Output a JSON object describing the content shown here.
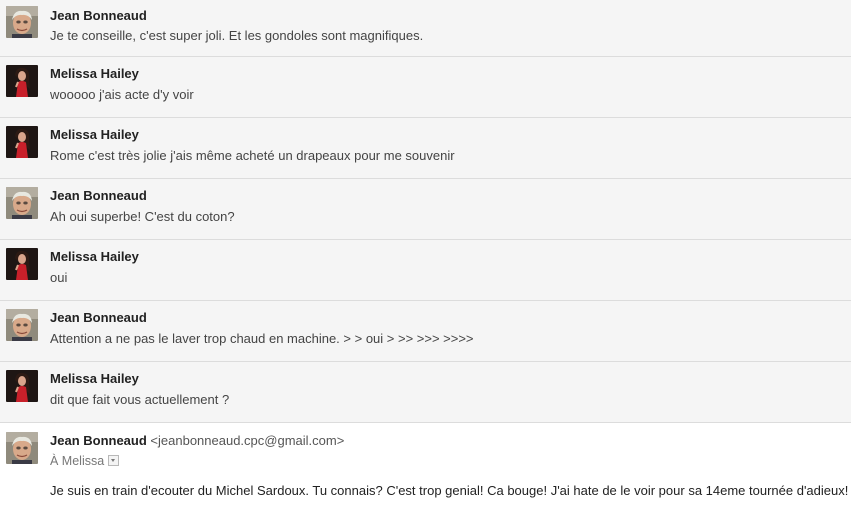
{
  "messages": [
    {
      "sender": "Jean Bonneaud",
      "avatar": "jean-avatar",
      "snippet": "Je te conseille, c'est super joli. Et les gondoles sont magnifiques."
    },
    {
      "sender": "Melissa Hailey",
      "avatar": "melissa-avatar",
      "snippet": "wooooo j'ais acte d'y voir"
    },
    {
      "sender": "Melissa Hailey",
      "avatar": "melissa-avatar",
      "snippet": "Rome c'est très jolie j'ais même acheté un drapeaux pour me souvenir"
    },
    {
      "sender": "Jean Bonneaud",
      "avatar": "jean-avatar",
      "snippet": "Ah oui superbe! C'est du coton?"
    },
    {
      "sender": "Melissa Hailey",
      "avatar": "melissa-avatar",
      "snippet": "oui"
    },
    {
      "sender": "Jean Bonneaud",
      "avatar": "jean-avatar",
      "snippet": "Attention a ne pas le laver trop chaud en machine. > > oui > >> >>> >>>>"
    },
    {
      "sender": "Melissa Hailey",
      "avatar": "melissa-avatar",
      "snippet": "dit que fait vous actuellement ?"
    }
  ],
  "expanded": {
    "sender": "Jean Bonneaud",
    "email": "<jeanbonneaud.cpc@gmail.com>",
    "to": "À Melissa",
    "body": "Je suis en train d'ecouter du Michel Sardoux. Tu connais? C'est trop genial! Ca bouge! J'ai hate de le voir pour sa 14eme tournée d'adieux!"
  }
}
